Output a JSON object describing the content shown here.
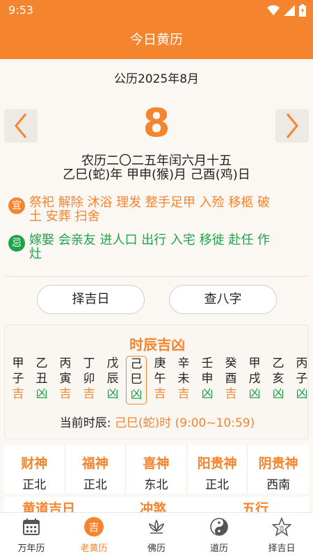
{
  "status": {
    "time": "9:53"
  },
  "header": {
    "title": "今日黄历"
  },
  "date": {
    "gregorian": "公历2025年8月",
    "day": "8",
    "lunar": "农历二〇二五年闰六月十五",
    "ganzhi": "乙巳(蛇)年 甲申(猴)月 己酉(鸡)日"
  },
  "yi": {
    "badge": "宜",
    "text": "祭祀 解除 沐浴 理发 整手足甲 入殓 移柩 破土 安葬 扫舍"
  },
  "ji": {
    "badge": "忌",
    "text": "嫁娶 会亲友 进人口 出行 入宅 移徙 赴任 作灶"
  },
  "buttons": {
    "zejiri": "择吉日",
    "chabazi": "查八字"
  },
  "shichen": {
    "title": "时辰吉凶",
    "items": [
      {
        "gz": "甲子",
        "v": "吉"
      },
      {
        "gz": "乙丑",
        "v": "凶"
      },
      {
        "gz": "丙寅",
        "v": "吉"
      },
      {
        "gz": "丁卯",
        "v": "吉"
      },
      {
        "gz": "戊辰",
        "v": "凶"
      },
      {
        "gz": "己巳",
        "v": "凶"
      },
      {
        "gz": "庚午",
        "v": "吉"
      },
      {
        "gz": "辛未",
        "v": "吉"
      },
      {
        "gz": "壬申",
        "v": "凶"
      },
      {
        "gz": "癸酉",
        "v": "吉"
      },
      {
        "gz": "甲戌",
        "v": "凶"
      },
      {
        "gz": "乙亥",
        "v": "凶"
      },
      {
        "gz": "丙子",
        "v": "凶"
      }
    ],
    "current_label": "当前时辰:",
    "current_value": "己巳(蛇)时 (9:00~10:59)"
  },
  "gods": [
    {
      "name": "财神",
      "dir": "正北"
    },
    {
      "name": "福神",
      "dir": "正北"
    },
    {
      "name": "喜神",
      "dir": "东北"
    },
    {
      "name": "阳贵神",
      "dir": "正北"
    },
    {
      "name": "阴贵神",
      "dir": "西南"
    }
  ],
  "cut_row": [
    "黄道吉日",
    "冲煞",
    "五行"
  ],
  "tabs": [
    {
      "label": "万年历",
      "icon": "calendar-icon"
    },
    {
      "label": "老黄历",
      "icon": "ji-circle-icon"
    },
    {
      "label": "佛历",
      "icon": "lotus-icon"
    },
    {
      "label": "道历",
      "icon": "yinyang-icon"
    },
    {
      "label": "择吉日",
      "icon": "star-icon"
    }
  ],
  "colors": {
    "accent": "#f5842e",
    "green": "#1fa34a"
  }
}
